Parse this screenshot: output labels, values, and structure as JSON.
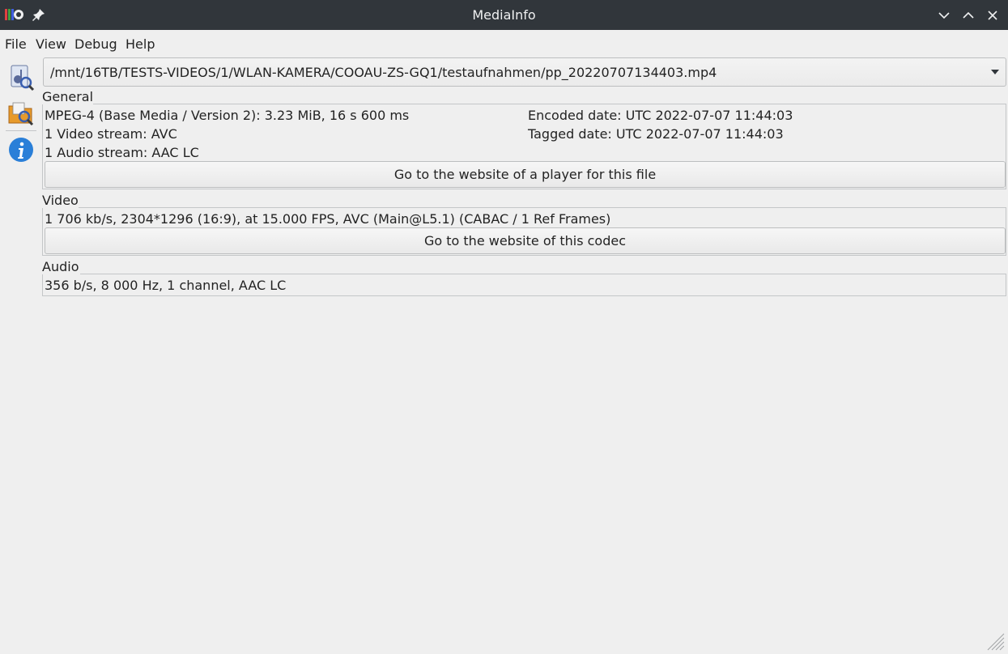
{
  "window": {
    "title": "MediaInfo",
    "app_icon": "mediainfo-logo-icon",
    "pin_icon": "pin-icon",
    "controls": [
      "minimize-icon",
      "maximize-icon",
      "close-icon"
    ]
  },
  "menu": {
    "items": [
      {
        "label": "File"
      },
      {
        "label": "View"
      },
      {
        "label": "Debug"
      },
      {
        "label": "Help"
      }
    ]
  },
  "toolbar": {
    "buttons": [
      {
        "icon": "open-file-icon"
      },
      {
        "icon": "open-folder-icon"
      },
      {
        "icon": "about-info-icon"
      }
    ]
  },
  "file": {
    "path": "/mnt/16TB/TESTS-VIDEOS/1/WLAN-KAMERA/COOAU-ZS-GQ1/testaufnahmen/pp_20220707134403.mp4"
  },
  "general": {
    "title": "General",
    "left_lines": [
      "MPEG-4 (Base Media / Version 2): 3.23 MiB, 16 s 600 ms",
      "1 Video stream: AVC",
      "1 Audio stream: AAC LC"
    ],
    "right_lines": [
      "Encoded date: UTC 2022-07-07 11:44:03",
      "Tagged date: UTC 2022-07-07 11:44:03"
    ],
    "button_label": "Go to the website of a player for this file"
  },
  "video": {
    "title": "Video",
    "line": "1 706 kb/s, 2304*1296 (16:9), at 15.000 FPS, AVC (Main@L5.1) (CABAC / 1 Ref Frames)",
    "button_label": "Go to the website of this codec"
  },
  "audio": {
    "title": "Audio",
    "line": "356 b/s, 8 000 Hz, 1 channel, AAC LC"
  },
  "colors": {
    "titlebar_bg": "#31363b",
    "window_bg": "#efefef",
    "info_icon_blue": "#2a7fd8"
  }
}
